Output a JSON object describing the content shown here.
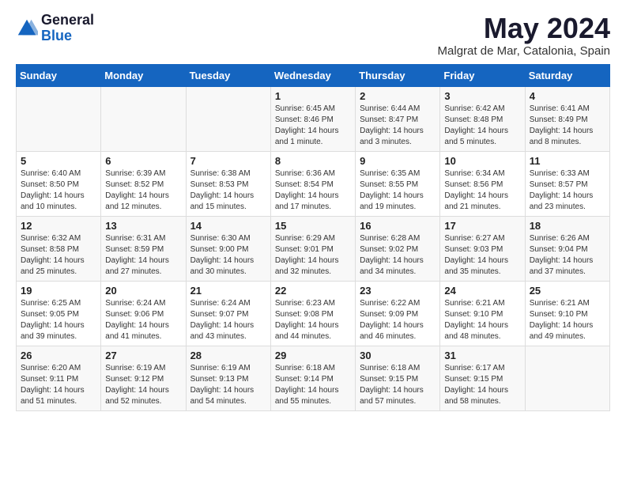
{
  "logo": {
    "general": "General",
    "blue": "Blue"
  },
  "title": "May 2024",
  "subtitle": "Malgrat de Mar, Catalonia, Spain",
  "days_of_week": [
    "Sunday",
    "Monday",
    "Tuesday",
    "Wednesday",
    "Thursday",
    "Friday",
    "Saturday"
  ],
  "weeks": [
    [
      {
        "day": "",
        "text": ""
      },
      {
        "day": "",
        "text": ""
      },
      {
        "day": "",
        "text": ""
      },
      {
        "day": "1",
        "text": "Sunrise: 6:45 AM\nSunset: 8:46 PM\nDaylight: 14 hours\nand 1 minute."
      },
      {
        "day": "2",
        "text": "Sunrise: 6:44 AM\nSunset: 8:47 PM\nDaylight: 14 hours\nand 3 minutes."
      },
      {
        "day": "3",
        "text": "Sunrise: 6:42 AM\nSunset: 8:48 PM\nDaylight: 14 hours\nand 5 minutes."
      },
      {
        "day": "4",
        "text": "Sunrise: 6:41 AM\nSunset: 8:49 PM\nDaylight: 14 hours\nand 8 minutes."
      }
    ],
    [
      {
        "day": "5",
        "text": "Sunrise: 6:40 AM\nSunset: 8:50 PM\nDaylight: 14 hours\nand 10 minutes."
      },
      {
        "day": "6",
        "text": "Sunrise: 6:39 AM\nSunset: 8:52 PM\nDaylight: 14 hours\nand 12 minutes."
      },
      {
        "day": "7",
        "text": "Sunrise: 6:38 AM\nSunset: 8:53 PM\nDaylight: 14 hours\nand 15 minutes."
      },
      {
        "day": "8",
        "text": "Sunrise: 6:36 AM\nSunset: 8:54 PM\nDaylight: 14 hours\nand 17 minutes."
      },
      {
        "day": "9",
        "text": "Sunrise: 6:35 AM\nSunset: 8:55 PM\nDaylight: 14 hours\nand 19 minutes."
      },
      {
        "day": "10",
        "text": "Sunrise: 6:34 AM\nSunset: 8:56 PM\nDaylight: 14 hours\nand 21 minutes."
      },
      {
        "day": "11",
        "text": "Sunrise: 6:33 AM\nSunset: 8:57 PM\nDaylight: 14 hours\nand 23 minutes."
      }
    ],
    [
      {
        "day": "12",
        "text": "Sunrise: 6:32 AM\nSunset: 8:58 PM\nDaylight: 14 hours\nand 25 minutes."
      },
      {
        "day": "13",
        "text": "Sunrise: 6:31 AM\nSunset: 8:59 PM\nDaylight: 14 hours\nand 27 minutes."
      },
      {
        "day": "14",
        "text": "Sunrise: 6:30 AM\nSunset: 9:00 PM\nDaylight: 14 hours\nand 30 minutes."
      },
      {
        "day": "15",
        "text": "Sunrise: 6:29 AM\nSunset: 9:01 PM\nDaylight: 14 hours\nand 32 minutes."
      },
      {
        "day": "16",
        "text": "Sunrise: 6:28 AM\nSunset: 9:02 PM\nDaylight: 14 hours\nand 34 minutes."
      },
      {
        "day": "17",
        "text": "Sunrise: 6:27 AM\nSunset: 9:03 PM\nDaylight: 14 hours\nand 35 minutes."
      },
      {
        "day": "18",
        "text": "Sunrise: 6:26 AM\nSunset: 9:04 PM\nDaylight: 14 hours\nand 37 minutes."
      }
    ],
    [
      {
        "day": "19",
        "text": "Sunrise: 6:25 AM\nSunset: 9:05 PM\nDaylight: 14 hours\nand 39 minutes."
      },
      {
        "day": "20",
        "text": "Sunrise: 6:24 AM\nSunset: 9:06 PM\nDaylight: 14 hours\nand 41 minutes."
      },
      {
        "day": "21",
        "text": "Sunrise: 6:24 AM\nSunset: 9:07 PM\nDaylight: 14 hours\nand 43 minutes."
      },
      {
        "day": "22",
        "text": "Sunrise: 6:23 AM\nSunset: 9:08 PM\nDaylight: 14 hours\nand 44 minutes."
      },
      {
        "day": "23",
        "text": "Sunrise: 6:22 AM\nSunset: 9:09 PM\nDaylight: 14 hours\nand 46 minutes."
      },
      {
        "day": "24",
        "text": "Sunrise: 6:21 AM\nSunset: 9:10 PM\nDaylight: 14 hours\nand 48 minutes."
      },
      {
        "day": "25",
        "text": "Sunrise: 6:21 AM\nSunset: 9:10 PM\nDaylight: 14 hours\nand 49 minutes."
      }
    ],
    [
      {
        "day": "26",
        "text": "Sunrise: 6:20 AM\nSunset: 9:11 PM\nDaylight: 14 hours\nand 51 minutes."
      },
      {
        "day": "27",
        "text": "Sunrise: 6:19 AM\nSunset: 9:12 PM\nDaylight: 14 hours\nand 52 minutes."
      },
      {
        "day": "28",
        "text": "Sunrise: 6:19 AM\nSunset: 9:13 PM\nDaylight: 14 hours\nand 54 minutes."
      },
      {
        "day": "29",
        "text": "Sunrise: 6:18 AM\nSunset: 9:14 PM\nDaylight: 14 hours\nand 55 minutes."
      },
      {
        "day": "30",
        "text": "Sunrise: 6:18 AM\nSunset: 9:15 PM\nDaylight: 14 hours\nand 57 minutes."
      },
      {
        "day": "31",
        "text": "Sunrise: 6:17 AM\nSunset: 9:15 PM\nDaylight: 14 hours\nand 58 minutes."
      },
      {
        "day": "",
        "text": ""
      }
    ]
  ]
}
